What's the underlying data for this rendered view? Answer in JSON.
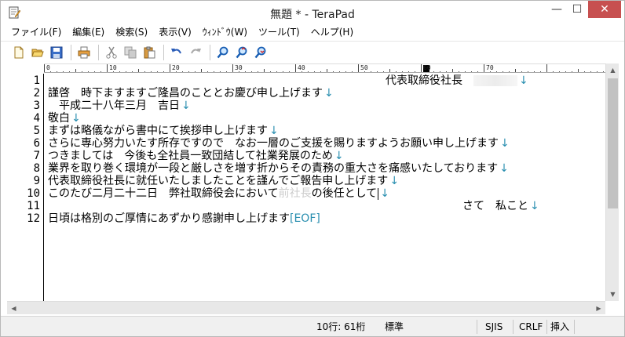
{
  "window": {
    "title": "無題 * - TeraPad",
    "minimize_glyph": "—",
    "maximize_glyph": "☐",
    "close_glyph": "✕"
  },
  "menu": [
    {
      "label": "ファイル(F)"
    },
    {
      "label": "編集(E)"
    },
    {
      "label": "検索(S)"
    },
    {
      "label": "表示(V)"
    },
    {
      "label": "ｳｨﾝﾄﾞｳ(W)"
    },
    {
      "label": "ツール(T)"
    },
    {
      "label": "ヘルプ(H)"
    }
  ],
  "toolbar": {
    "icons": [
      "new-file-icon",
      "open-folder-icon",
      "save-icon",
      "print-icon",
      "cut-icon",
      "copy-icon",
      "paste-icon",
      "undo-icon",
      "redo-icon",
      "search-icon",
      "search-prev-icon",
      "search-next-icon"
    ]
  },
  "ruler": {
    "labels": [
      "0",
      "10",
      "20",
      "30",
      "40",
      "50",
      "60",
      "70"
    ]
  },
  "editor": {
    "line_numbers": [
      "1",
      "2",
      "3",
      "4",
      "5",
      "6",
      "7",
      "8",
      "9",
      "10",
      "11",
      "12"
    ],
    "lines": [
      {
        "text": "代表取締役社長　",
        "indent": "right",
        "redacted_tail": true
      },
      {
        "text": "謹啓　時下ますますご隆昌のこととお慶び申し上げます"
      },
      {
        "text": "　平成二十八年三月　吉日"
      },
      {
        "text": "敬白"
      },
      {
        "text": "まずは略儀ながら書中にて挨拶申し上げます"
      },
      {
        "text": "さらに専心努力いたす所存ですので　なお一層のご支援を賜りますようお願い申し上げます"
      },
      {
        "text": "つきましては　今後も全社員一致団結して社業発展のため"
      },
      {
        "text": "業界を取り巻く環境が一段と厳しさを増す折からその責務の重大さを痛感いたしております"
      },
      {
        "text": "代表取締役社長に就任いたしましたことを謹んでご報告申し上げます"
      },
      {
        "text": "このたび二月二十二日　弊社取締役会において",
        "redacted_mid": "前社長",
        "tail": "の後任として"
      },
      {
        "text": "さて　私こと",
        "indent": "right"
      },
      {
        "text": "日頃は格別のご厚情にあずかり感謝申し上げます",
        "eof": "[EOF]"
      }
    ],
    "newline_mark": "↓"
  },
  "status": {
    "position": "10行:  61桁",
    "mode": "標準",
    "encoding": "SJIS",
    "line_ending": "CRLF",
    "insert_mode": "挿入"
  },
  "colors": {
    "newline_mark": "#2a8fb0",
    "close_button": "#c75050"
  }
}
